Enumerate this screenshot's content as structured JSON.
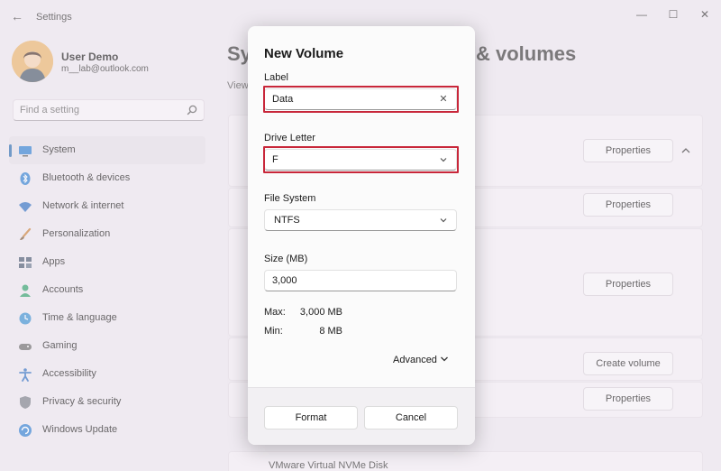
{
  "window": {
    "title": "Settings",
    "back_glyph": "←",
    "minimize_glyph": "—",
    "maximize_glyph": "☐",
    "close_glyph": "✕"
  },
  "user": {
    "name": "User Demo",
    "email": "m__lab@outlook.com"
  },
  "search": {
    "placeholder": "Find a setting"
  },
  "sidebar": {
    "items": [
      {
        "label": "System",
        "icon": "monitor-icon",
        "active": true
      },
      {
        "label": "Bluetooth & devices",
        "icon": "bluetooth-icon"
      },
      {
        "label": "Network & internet",
        "icon": "wifi-icon"
      },
      {
        "label": "Personalization",
        "icon": "brush-icon"
      },
      {
        "label": "Apps",
        "icon": "apps-icon"
      },
      {
        "label": "Accounts",
        "icon": "person-icon"
      },
      {
        "label": "Time & language",
        "icon": "globe-clock-icon"
      },
      {
        "label": "Gaming",
        "icon": "gamepad-icon"
      },
      {
        "label": "Accessibility",
        "icon": "accessibility-icon"
      },
      {
        "label": "Privacy & security",
        "icon": "shield-icon"
      },
      {
        "label": "Windows Update",
        "icon": "update-icon"
      }
    ]
  },
  "main": {
    "title_left": "Sy",
    "title_right": "& volumes",
    "view_label": "View",
    "properties_label": "Properties",
    "create_volume_label": "Create volume",
    "disk_name": "VMware Virtual NVMe Disk"
  },
  "dialog": {
    "title": "New Volume",
    "label_field": {
      "label": "Label",
      "value": "Data"
    },
    "drive_letter": {
      "label": "Drive Letter",
      "value": "F"
    },
    "file_system": {
      "label": "File System",
      "value": "NTFS"
    },
    "size": {
      "label": "Size (MB)",
      "value": "3,000"
    },
    "max": {
      "key": "Max:",
      "value": "3,000 MB"
    },
    "min": {
      "key": "Min:",
      "value": "8 MB"
    },
    "advanced_label": "Advanced",
    "format_label": "Format",
    "cancel_label": "Cancel"
  },
  "colors": {
    "accent": "#2b6cb0",
    "highlight": "#c8273a"
  }
}
